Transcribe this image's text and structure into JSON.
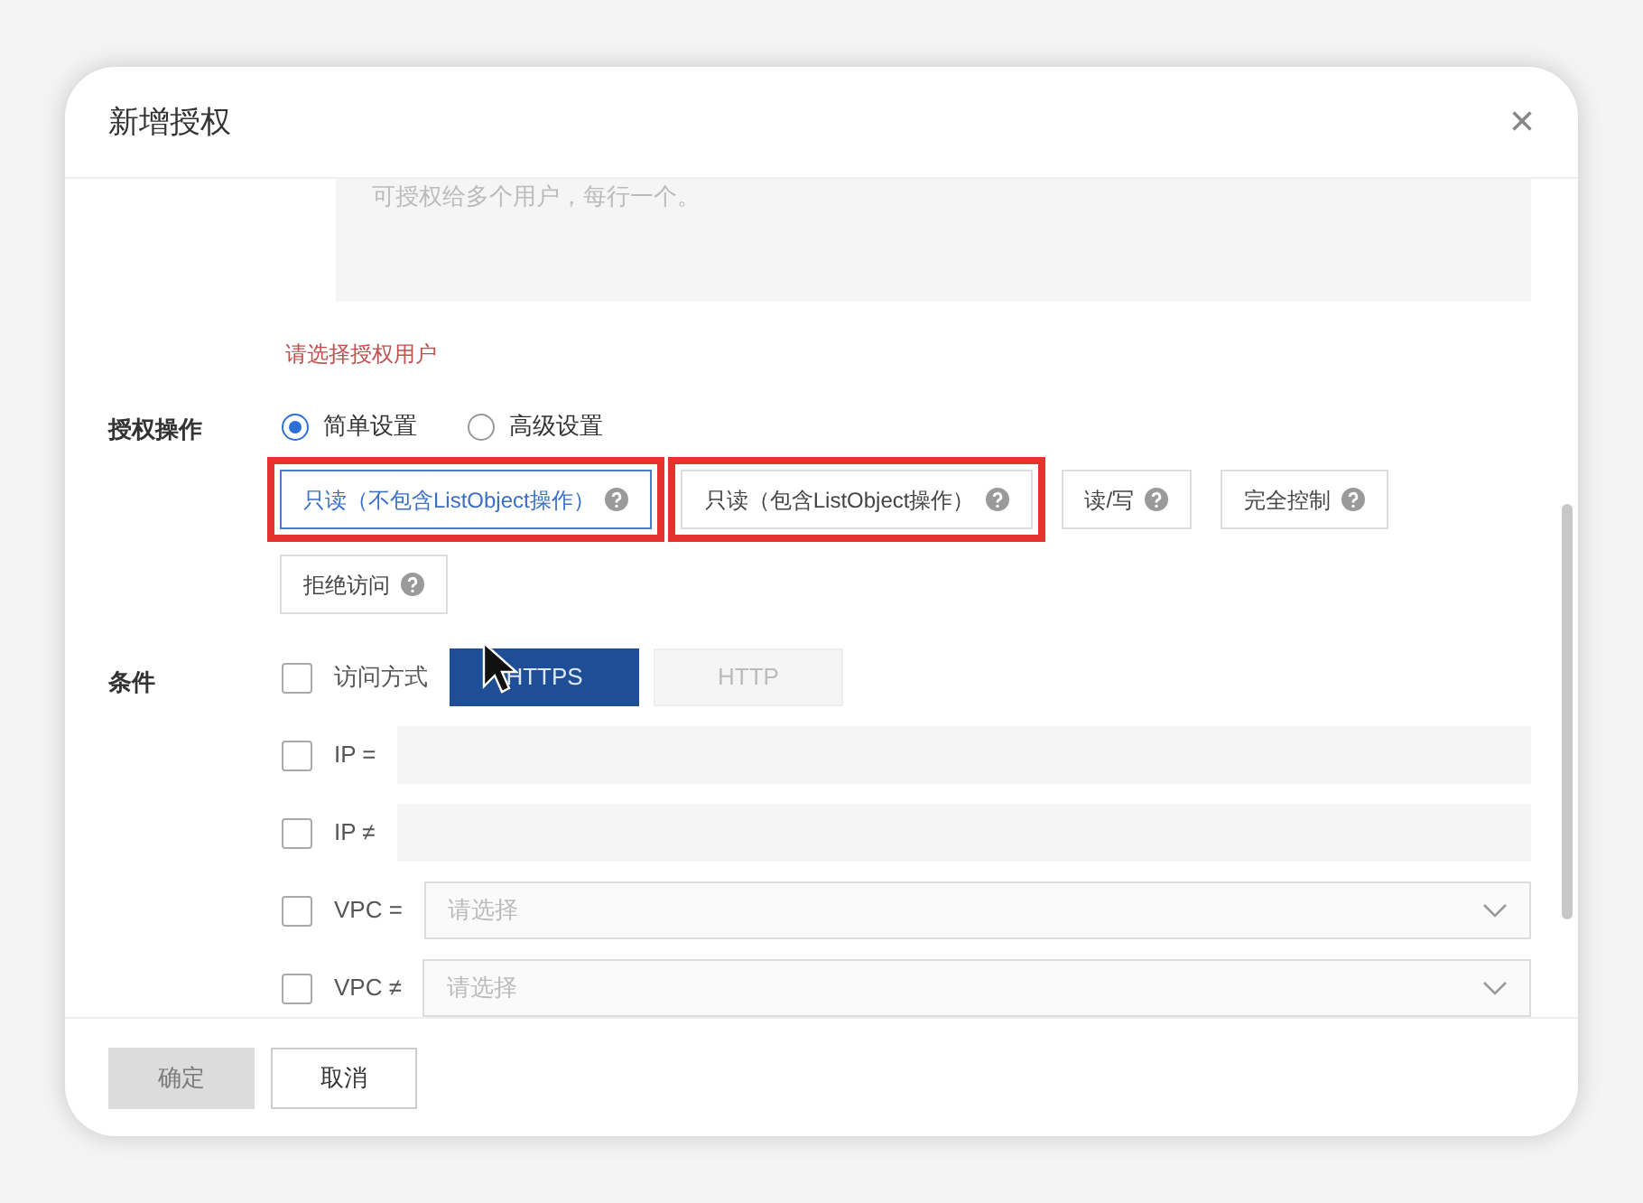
{
  "dialog": {
    "title": "新增授权",
    "close": "×"
  },
  "users": {
    "placeholder": "可授权给多个用户，每行一个。",
    "error": "请选择授权用户"
  },
  "operation": {
    "label": "授权操作",
    "modes": [
      {
        "label": "简单设置",
        "selected": true
      },
      {
        "label": "高级设置",
        "selected": false
      }
    ],
    "options": [
      {
        "label": "只读（不包含ListObject操作）",
        "selected": true,
        "annotated": true
      },
      {
        "label": "只读（包含ListObject操作）",
        "selected": false,
        "annotated": true
      },
      {
        "label": "读/写",
        "selected": false,
        "annotated": false
      },
      {
        "label": "完全控制",
        "selected": false,
        "annotated": false
      },
      {
        "label": "拒绝访问",
        "selected": false,
        "annotated": false
      }
    ]
  },
  "conditions": {
    "label": "条件",
    "items": [
      {
        "kind": "protocol",
        "label": "访问方式",
        "checked": false,
        "choices": [
          {
            "label": "HTTPS",
            "selected": true
          },
          {
            "label": "HTTP",
            "selected": false
          }
        ]
      },
      {
        "kind": "input",
        "label": "IP =",
        "checked": false
      },
      {
        "kind": "input",
        "label": "IP ≠",
        "checked": false
      },
      {
        "kind": "select",
        "label": "VPC =",
        "checked": false,
        "placeholder": "请选择"
      },
      {
        "kind": "select",
        "label": "VPC ≠",
        "checked": false,
        "placeholder": "请选择"
      }
    ]
  },
  "footer": {
    "buttons": [
      {
        "label": "确定",
        "disabled": true
      },
      {
        "label": "取消",
        "disabled": false
      }
    ]
  }
}
